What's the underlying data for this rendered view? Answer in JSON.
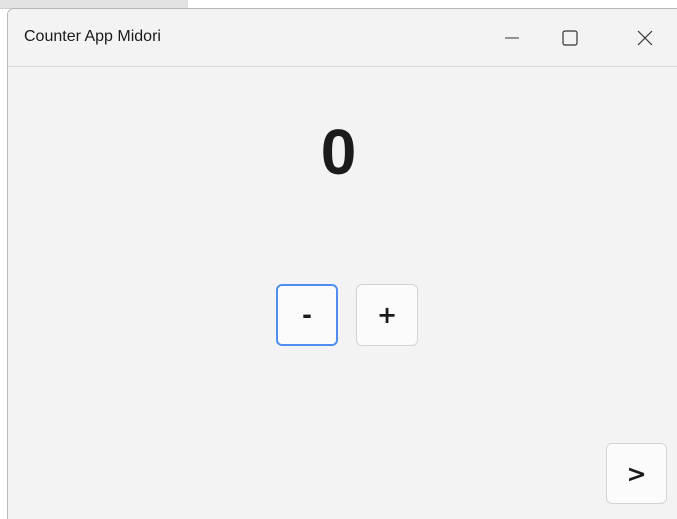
{
  "window": {
    "title": "Counter App Midori",
    "controls": {
      "minimize": "minimize-icon",
      "maximize": "maximize-icon",
      "close": "close-icon"
    }
  },
  "counter": {
    "value": "0"
  },
  "buttons": {
    "decrement_label": "-",
    "increment_label": "+",
    "next_label": ">"
  },
  "colors": {
    "window_background": "#f3f3f3",
    "focus_ring": "#4d8ef0",
    "text": "#1b1b1b"
  }
}
